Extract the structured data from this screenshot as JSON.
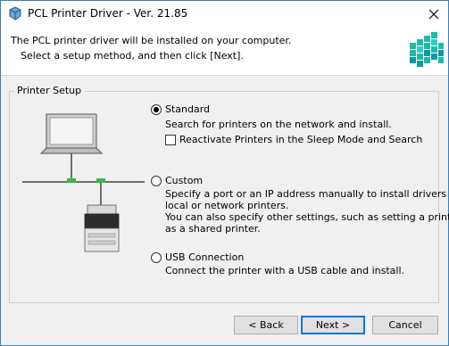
{
  "window": {
    "title": "PCL Printer Driver - Ver. 21.85"
  },
  "header": {
    "line1": "The PCL printer driver will be installed on your computer.",
    "line2": "Select a setup method, and then click [Next]."
  },
  "group": {
    "label": "Printer Setup",
    "options": {
      "standard": {
        "label": "Standard",
        "selected": true,
        "description": "Search for printers on the network and install.",
        "checkbox": {
          "label": "Reactivate Printers in the Sleep Mode and Search",
          "checked": false
        }
      },
      "custom": {
        "label": "Custom",
        "selected": false,
        "line1": "Specify a port or an IP address manually to install drivers of",
        "line2": "local or network printers.",
        "line3": "You can also specify other settings, such as setting a printer",
        "line4": "as a shared printer."
      },
      "usb": {
        "label": "USB Connection",
        "selected": false,
        "description": "Connect the printer with a USB cable and install."
      }
    }
  },
  "buttons": {
    "back": "< Back",
    "next": "Next >",
    "cancel": "Cancel"
  },
  "colors": {
    "accent": "#0078d7",
    "logo": "#19b5b0"
  }
}
